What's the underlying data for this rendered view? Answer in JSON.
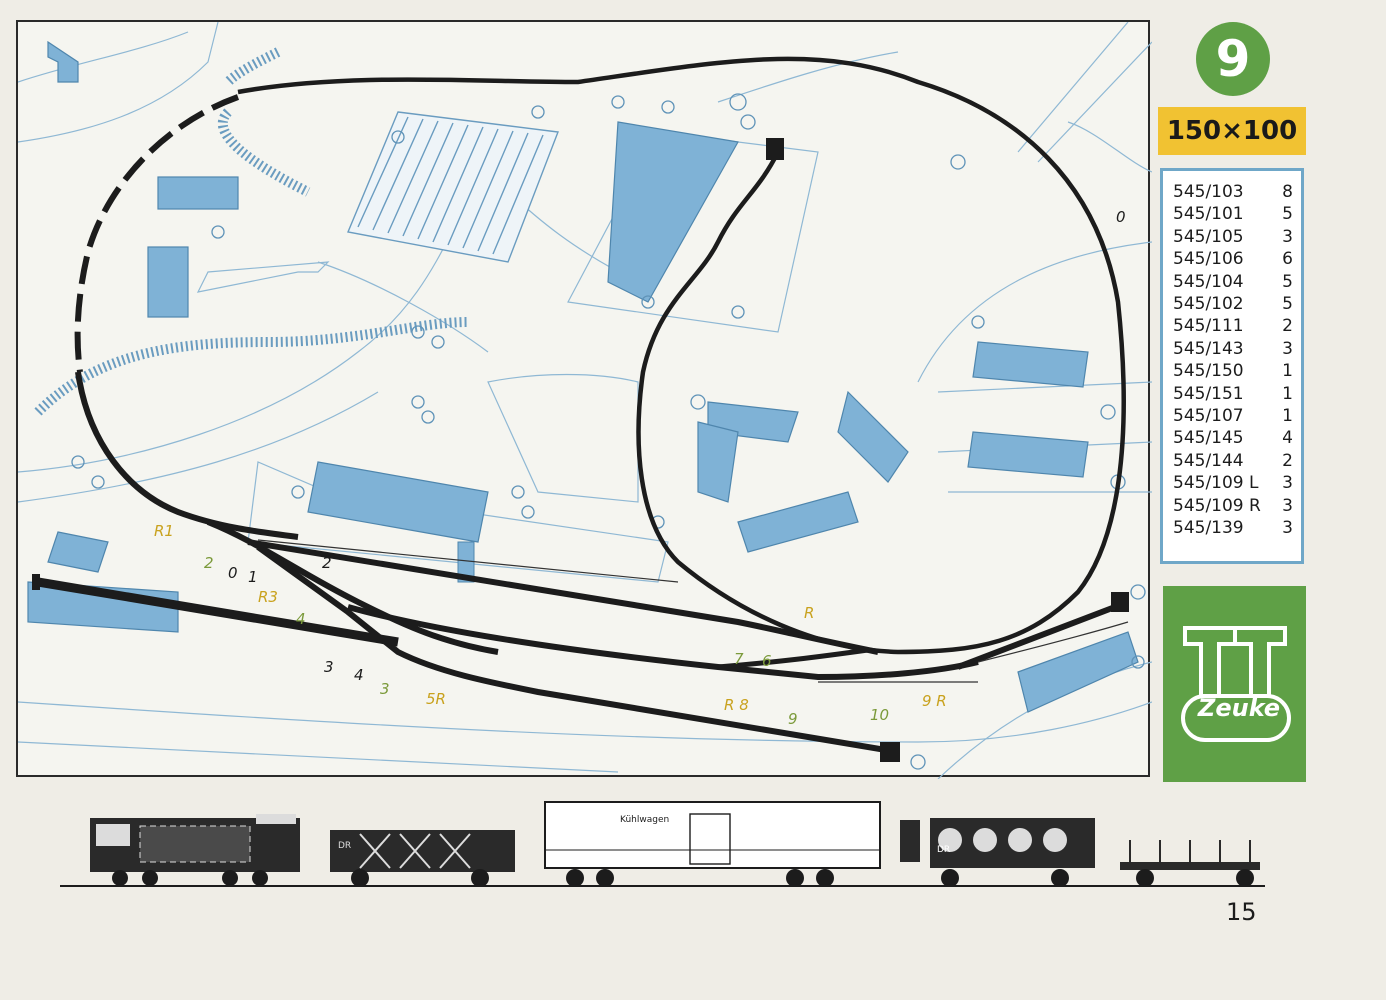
{
  "layout": {
    "number": "9",
    "size": "150×100"
  },
  "parts": [
    {
      "code": "545/103",
      "qty": "8"
    },
    {
      "code": "545/101",
      "qty": "5"
    },
    {
      "code": "545/105",
      "qty": "3"
    },
    {
      "code": "545/106",
      "qty": "6"
    },
    {
      "code": "545/104",
      "qty": "5"
    },
    {
      "code": "545/102",
      "qty": "5"
    },
    {
      "code": "545/111",
      "qty": "2"
    },
    {
      "code": "545/143",
      "qty": "3"
    },
    {
      "code": "545/150",
      "qty": "1"
    },
    {
      "code": "545/151",
      "qty": "1"
    },
    {
      "code": "545/107",
      "qty": "1"
    },
    {
      "code": "545/145",
      "qty": "4"
    },
    {
      "code": "545/144",
      "qty": "2"
    },
    {
      "code": "545/109 L",
      "qty": "3"
    },
    {
      "code": "545/109 R",
      "qty": "3"
    },
    {
      "code": "545/139",
      "qty": "3"
    }
  ],
  "brand": {
    "mark": "TT",
    "name": "Zeuke"
  },
  "track_labels": {
    "r1": "R1",
    "n2a": "2",
    "n0": "0",
    "n1": "1",
    "n2b": "2",
    "r3": "R3",
    "n4": "4",
    "n3": "3",
    "n4b": "4",
    "n3b": "3",
    "r5": "5R",
    "n0top": "0",
    "r_right": "R",
    "n7": "7",
    "n6": "6",
    "r8": "R 8",
    "n9": "9",
    "n10": "10",
    "r9": "9 R"
  },
  "wagon_labels": {
    "reefer": "Kühlwagen",
    "dr1": "DR",
    "dr2": "DR"
  },
  "page_number": "15"
}
